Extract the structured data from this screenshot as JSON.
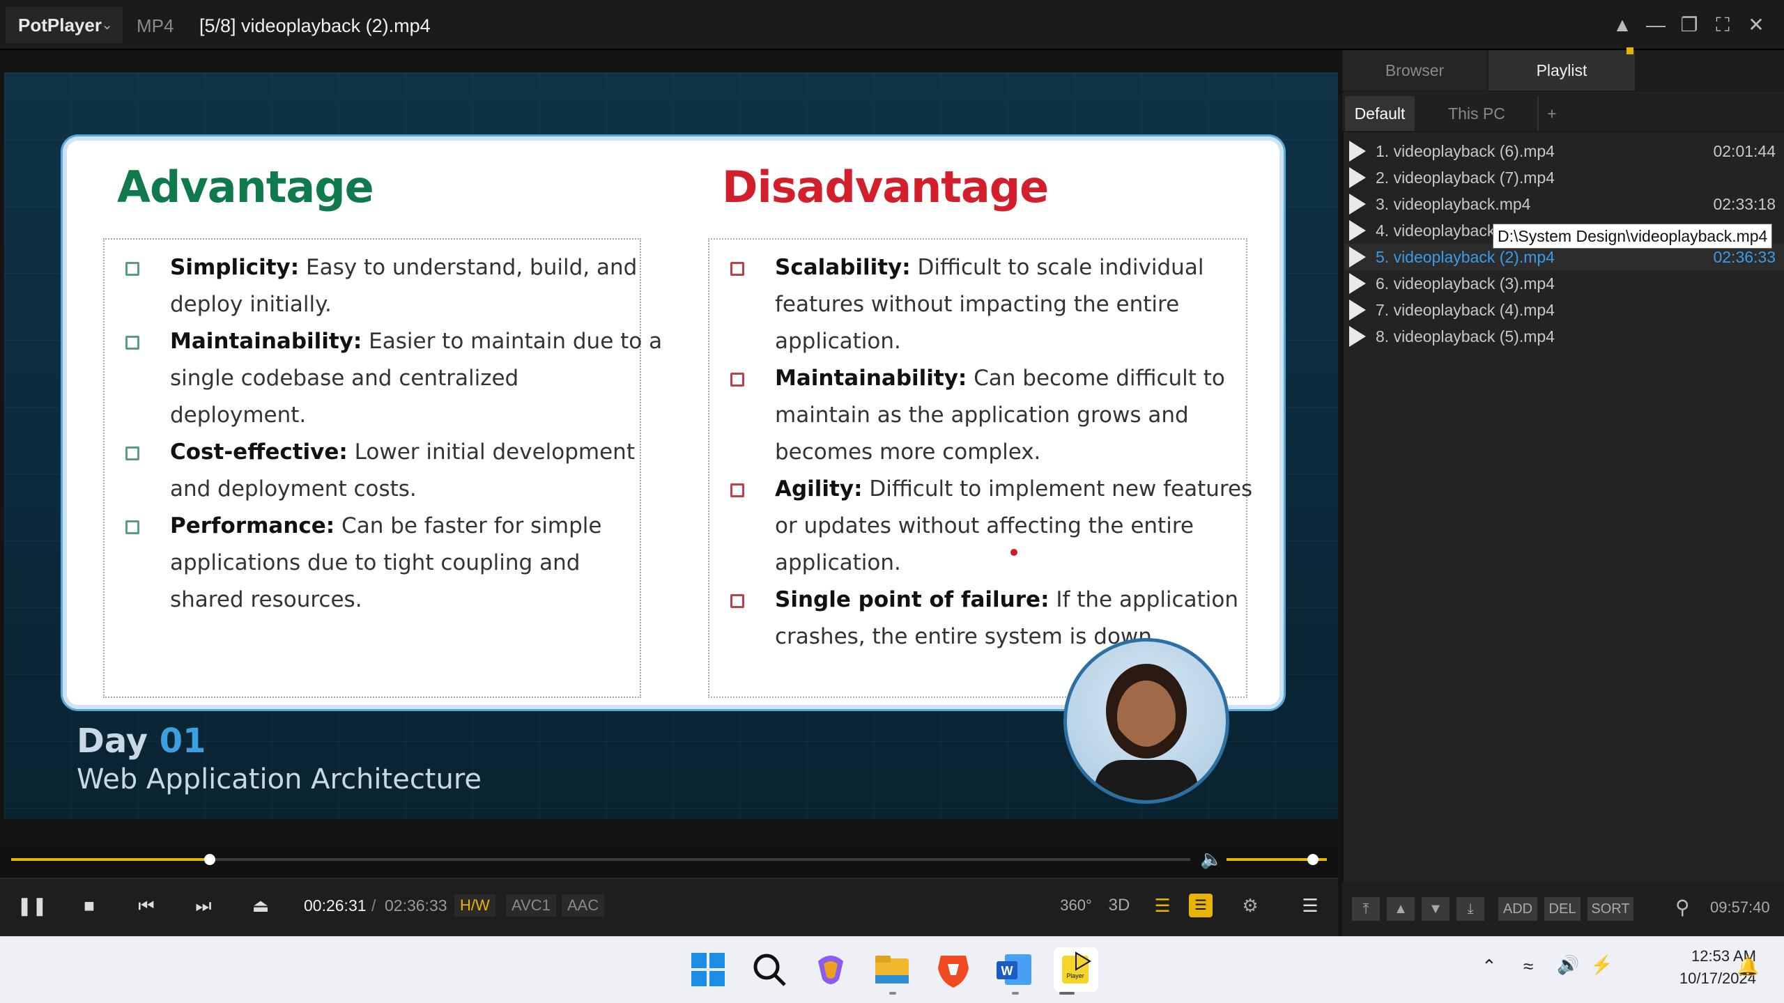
{
  "titlebar": {
    "app_name": "PotPlayer",
    "format": "MP4",
    "title": "[5/8] videoplayback (2).mp4"
  },
  "slide": {
    "advantage_heading": "Advantage",
    "disadvantage_heading": "Disadvantage",
    "advantages": [
      {
        "term": "Simplicity:",
        "lines": [
          " Easy to understand, build, and",
          "deploy initially."
        ]
      },
      {
        "term": "Maintainability:",
        "lines": [
          " Easier to maintain due to a",
          "single codebase and centralized",
          "deployment."
        ]
      },
      {
        "term": "Cost-effective:",
        "lines": [
          " Lower initial development",
          "and deployment costs."
        ]
      },
      {
        "term": "Performance:",
        "lines": [
          " Can be faster for simple",
          "applications due to tight coupling and",
          "shared resources."
        ]
      }
    ],
    "disadvantages": [
      {
        "term": "Scalability:",
        "lines": [
          " Difficult to scale individual",
          "features without impacting the entire",
          "application."
        ]
      },
      {
        "term": "Maintainability:",
        "lines": [
          " Can become difficult to",
          "maintain as the application grows and",
          "becomes more complex."
        ]
      },
      {
        "term": "Agility:",
        "lines": [
          " Difficult to implement new features",
          "or updates without affecting the entire",
          "application."
        ]
      },
      {
        "term": "Single point of failure:",
        "lines": [
          " If the application",
          "crashes, the entire system is down."
        ]
      }
    ],
    "day_label": "Day",
    "day_number": "01",
    "subtitle": "Web Application Architecture"
  },
  "player": {
    "progress_fraction": 0.1682,
    "volume_fraction": 0.86,
    "time_current": "00:26:31",
    "time_separator": "/",
    "time_total": "02:36:33",
    "tags": {
      "hw": "H/W",
      "video": "AVC1",
      "audio": "AAC"
    }
  },
  "panel": {
    "tabs": {
      "browser": "Browser",
      "playlist": "Playlist"
    },
    "subtabs": {
      "default": "Default",
      "this_pc": "This PC",
      "add": "+"
    },
    "items": [
      {
        "label": "1. videoplayback (6).mp4",
        "duration": "02:01:44"
      },
      {
        "label": "2. videoplayback (7).mp4",
        "duration": ""
      },
      {
        "label": "3. videoplayback.mp4",
        "duration": "02:33:18"
      },
      {
        "label": "4. videoplayback",
        "duration": ""
      },
      {
        "label": "5. videoplayback (2).mp4",
        "duration": "02:36:33"
      },
      {
        "label": "6. videoplayback (3).mp4",
        "duration": ""
      },
      {
        "label": "7. videoplayback (4).mp4",
        "duration": ""
      },
      {
        "label": "8. videoplayback (5).mp4",
        "duration": ""
      }
    ],
    "active_index": 4,
    "tooltip": "D:\\System Design\\videoplayback.mp4",
    "buttons": {
      "add": "ADD",
      "del": "DEL",
      "sort": "SORT"
    },
    "total_time": "09:57:40"
  },
  "taskbar": {
    "time": "12:53 AM",
    "date": "10/17/2024",
    "player_icon_text": "Player"
  },
  "colors": {
    "accent": "#e8b400",
    "playlist_active": "#3a9be8",
    "advantage": "#0f7a4b",
    "disadvantage": "#d31f2b"
  }
}
